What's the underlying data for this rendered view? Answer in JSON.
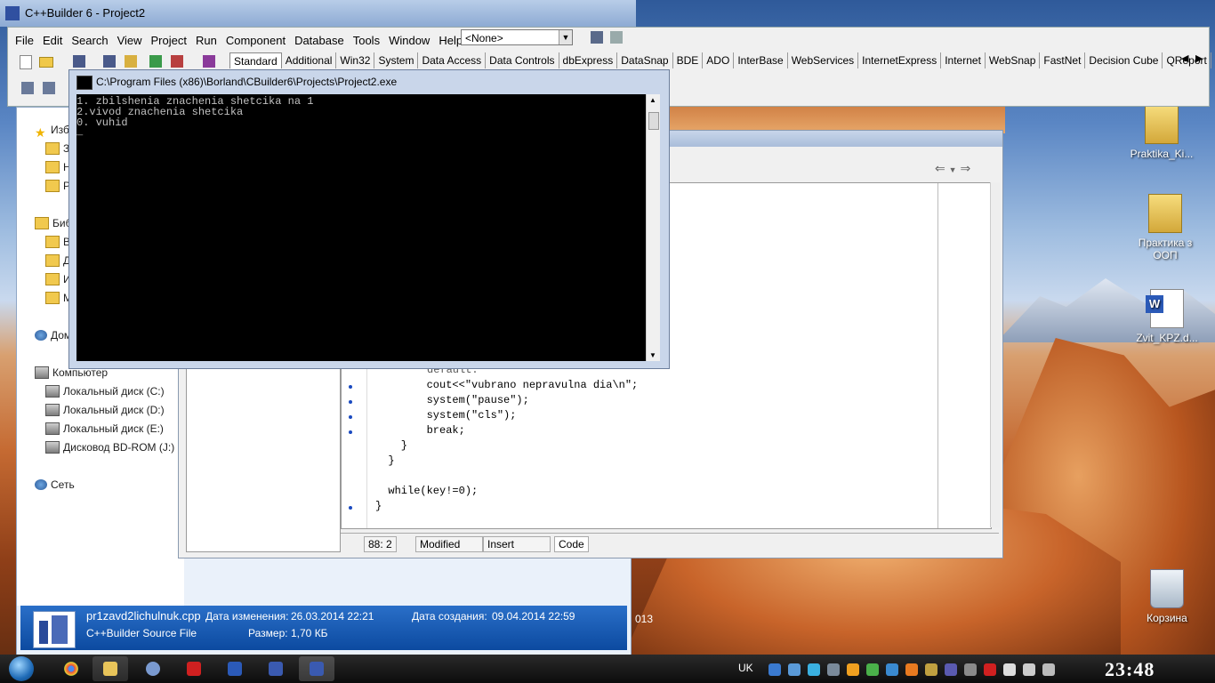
{
  "app": {
    "title": "C++Builder 6 - Project2",
    "menu": [
      "File",
      "Edit",
      "Search",
      "View",
      "Project",
      "Run",
      "Component",
      "Database",
      "Tools",
      "Window",
      "Help"
    ],
    "combo_value": "<None>",
    "palette_tabs": [
      "Standard",
      "Additional",
      "Win32",
      "System",
      "Data Access",
      "Data Controls",
      "dbExpress",
      "DataSnap",
      "BDE",
      "ADO",
      "InterBase",
      "WebServices",
      "InternetExpress",
      "Internet",
      "WebSnap",
      "FastNet",
      "Decision Cube",
      "QReport"
    ]
  },
  "console": {
    "title": "C:\\Program Files (x86)\\Borland\\CBuilder6\\Projects\\Project2.exe",
    "lines": [
      "1. zbilshenia znachenia shetcika na 1",
      "2.vivod znachenia shetcika",
      "0. vuhid",
      "_"
    ]
  },
  "editor": {
    "partial_line": "default:",
    "lines": [
      "        cout<<\"vubrano nepravulna dia\\n\";",
      "        system(\"pause\");",
      "        system(\"cls\");",
      "        break;",
      "    }",
      "  }",
      "",
      "  while(key!=0);",
      "}"
    ],
    "status": {
      "pos": "88:  2",
      "modified": "Modified",
      "mode": "Insert",
      "tab": "Code"
    }
  },
  "explorer": {
    "nav": [
      {
        "label": "Изб",
        "icon": "star-icon"
      },
      {
        "label": "Зa",
        "icon": "folder-icon"
      },
      {
        "label": "Не",
        "icon": "folder-icon"
      },
      {
        "label": "Ра",
        "icon": "folder-icon"
      },
      {
        "label": "Биб",
        "icon": "library-icon"
      },
      {
        "label": "Ви",
        "icon": "folder-icon"
      },
      {
        "label": "До",
        "icon": "folder-icon"
      },
      {
        "label": "Из",
        "icon": "folder-icon"
      },
      {
        "label": "Му",
        "icon": "folder-icon"
      },
      {
        "label": "Дом",
        "icon": "homegroup-icon"
      },
      {
        "label": "Компьютер",
        "icon": "computer-icon"
      },
      {
        "label": "Локальный диск (C:)",
        "icon": "drive-icon"
      },
      {
        "label": "Локальный диск (D:)",
        "icon": "drive-icon"
      },
      {
        "label": "Локальный диск (E:)",
        "icon": "drive-icon"
      },
      {
        "label": "Дисковод BD-ROM (J:)",
        "icon": "optical-drive-icon"
      },
      {
        "label": "Сеть",
        "icon": "network-icon"
      }
    ],
    "details": {
      "filename": "pr1zavd2lichulnuk.cpp",
      "modified_label": "Дата изменения:",
      "modified_value": "26.03.2014 22:21",
      "created_label": "Дата создания:",
      "created_value": "09.04.2014 22:59",
      "type": "C++Builder Source File",
      "size_label": "Размер:",
      "size_value": "1,70 КБ"
    },
    "year_fragment": "013"
  },
  "desktop_icons": [
    {
      "label": "Praktika_Ki...",
      "icon": "zip-folder-icon"
    },
    {
      "label": "Практика з ООП",
      "icon": "folder-icon"
    },
    {
      "label": "Zvit_KPZ.d...",
      "icon": "word-doc-icon"
    },
    {
      "label": "Корзина",
      "icon": "recycle-bin-icon"
    }
  ],
  "taskbar": {
    "lang": "UK",
    "clock": "23:48",
    "apps": [
      "chrome-icon",
      "explorer-icon",
      "media-icon",
      "pdf-icon",
      "word-icon",
      "cbuilder-icon",
      "cbuilder-console-icon"
    ]
  },
  "colors": {
    "console_bg": "#000000",
    "details_bg": "#0c4aa0",
    "code_string": "#00007f"
  }
}
